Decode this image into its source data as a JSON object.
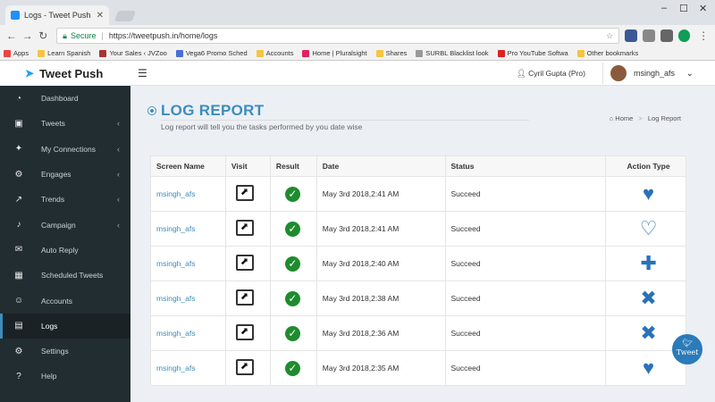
{
  "browser": {
    "tab_title": "Logs - Tweet Push",
    "secure_label": "Secure",
    "url": "https://tweetpush.in/home/logs"
  },
  "bookmarks": [
    {
      "label": "Apps",
      "color": "#e44"
    },
    {
      "label": "Learn Spanish",
      "color": "#f4c542"
    },
    {
      "label": "Your Sales ‹ JVZoo",
      "color": "#a33"
    },
    {
      "label": "Vega6 Promo Sched",
      "color": "#4a6fd6"
    },
    {
      "label": "Accounts",
      "color": "#f4c542"
    },
    {
      "label": "Home | Pluralsight",
      "color": "#e0245e"
    },
    {
      "label": "Shares",
      "color": "#f4c542"
    },
    {
      "label": "SURBL Blacklist look",
      "color": "#999"
    },
    {
      "label": "Pro YouTube Softwa",
      "color": "#d22"
    },
    {
      "label": "Other bookmarks",
      "color": "#f4c542"
    }
  ],
  "brand": {
    "name": "Tweet Push"
  },
  "sidebar": {
    "items": [
      {
        "label": "Dashboard",
        "icon": "◔",
        "chev": ""
      },
      {
        "label": "Tweets",
        "icon": "▣",
        "chev": "‹"
      },
      {
        "label": "My Connections",
        "icon": "✦",
        "chev": "‹"
      },
      {
        "label": "Engages",
        "icon": "⚙",
        "chev": "‹"
      },
      {
        "label": "Trends",
        "icon": "↗",
        "chev": "‹"
      },
      {
        "label": "Campaign",
        "icon": "♪",
        "chev": "‹"
      },
      {
        "label": "Auto Reply",
        "icon": "✉",
        "chev": ""
      },
      {
        "label": "Scheduled Tweets",
        "icon": "▦",
        "chev": ""
      },
      {
        "label": "Accounts",
        "icon": "☺",
        "chev": ""
      },
      {
        "label": "Logs",
        "icon": "▤",
        "chev": ""
      },
      {
        "label": "Settings",
        "icon": "⚙",
        "chev": ""
      },
      {
        "label": "Help",
        "icon": "?",
        "chev": ""
      }
    ]
  },
  "topbar": {
    "user_pro": "Cyril Gupta (Pro)",
    "account": "msingh_afs"
  },
  "page": {
    "title": "LOG REPORT",
    "subtitle": "Log report will tell you the tasks performed by you date wise",
    "crumb_home": "Home",
    "crumb_current": "Log Report"
  },
  "table": {
    "headers": [
      "Screen Name",
      "Visit",
      "Result",
      "Date",
      "Status",
      "Action Type"
    ],
    "rows": [
      {
        "name": "msingh_afs",
        "date": "May 3rd 2018,2:41 AM",
        "status": "Succeed",
        "action": "♥"
      },
      {
        "name": "msingh_afs",
        "date": "May 3rd 2018,2:41 AM",
        "status": "Succeed",
        "action": "♡"
      },
      {
        "name": "msingh_afs",
        "date": "May 3rd 2018,2:40 AM",
        "status": "Succeed",
        "action": "✚"
      },
      {
        "name": "msingh_afs",
        "date": "May 3rd 2018,2:38 AM",
        "status": "Succeed",
        "action": "✖"
      },
      {
        "name": "msingh_afs",
        "date": "May 3rd 2018,2:36 AM",
        "status": "Succeed",
        "action": "✖"
      },
      {
        "name": "msingh_afs",
        "date": "May 3rd 2018,2:35 AM",
        "status": "Succeed",
        "action": "♥"
      }
    ]
  },
  "tweet_button": "Tweet"
}
